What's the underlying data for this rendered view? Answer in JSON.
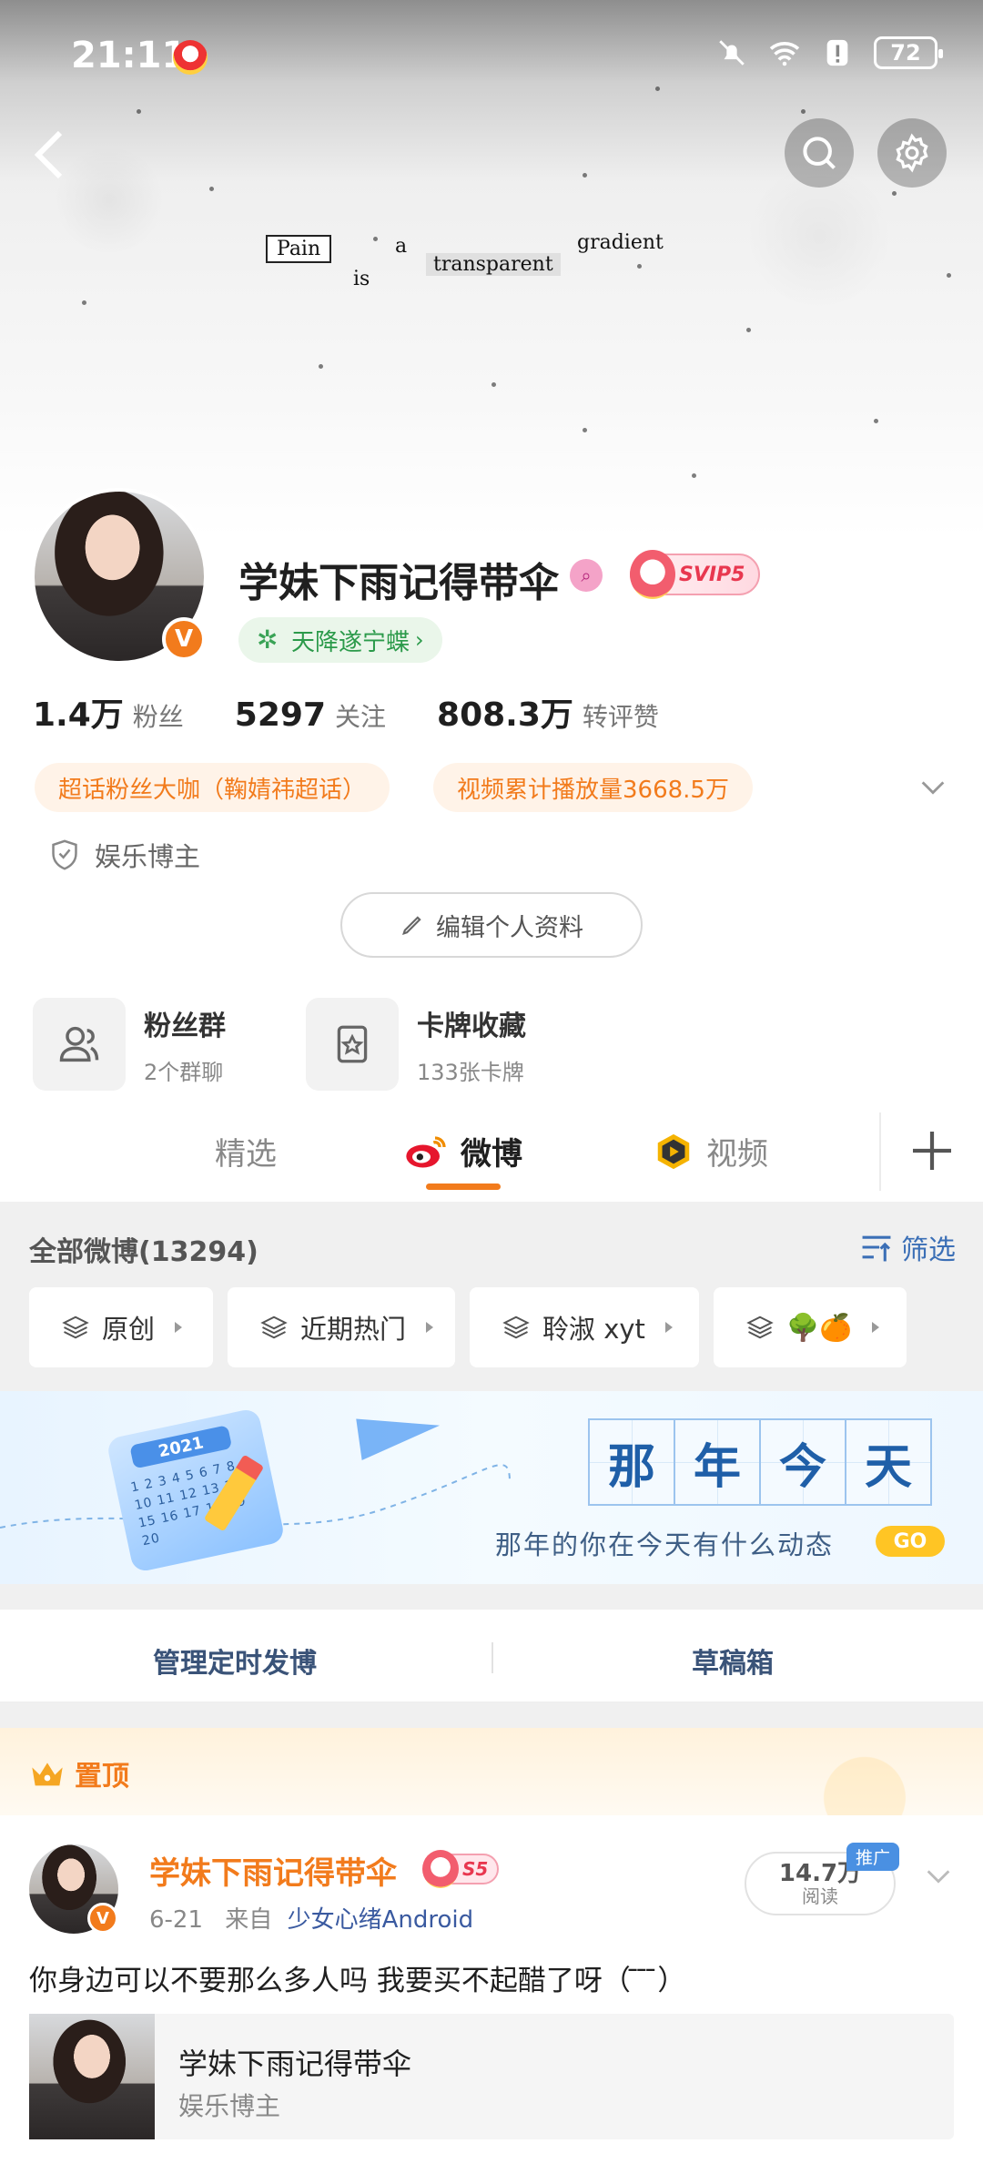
{
  "status": {
    "time": "21:11",
    "battery": "72"
  },
  "cover": {
    "quote_words": [
      "Pain",
      "is",
      "a",
      "transparent",
      "gradient"
    ]
  },
  "profile": {
    "name": "学妹下雨记得带伞",
    "svip_label": "SVIP5",
    "chaohua": "天降遂宁蝶",
    "stats": [
      {
        "num": "1.4万",
        "label": "粉丝"
      },
      {
        "num": "5297",
        "label": "关注"
      },
      {
        "num": "808.3万",
        "label": "转评赞"
      }
    ],
    "tags": [
      "超话粉丝大咖（鞠婧祎超话）",
      "视频累计播放量3668.5万"
    ],
    "verify": "娱乐博主",
    "edit_label": "编辑个人资料"
  },
  "features": [
    {
      "title": "粉丝群",
      "sub": "2个群聊"
    },
    {
      "title": "卡牌收藏",
      "sub": "133张卡牌"
    }
  ],
  "tabs": [
    "精选",
    "微博",
    "视频"
  ],
  "filter": {
    "title": "全部微博(13294)",
    "button": "筛选",
    "chips": [
      "原创",
      "近期热门",
      "聆淑 xyt",
      "🌳🍊"
    ]
  },
  "banner": {
    "cal_year": "2021",
    "cal_days": "1 2 3 4 5 6 7 8 9 10 11 12 13 14 15 16 17 18 19 20",
    "grid": [
      "那",
      "年",
      "今",
      "天"
    ],
    "subtitle": "那年的你在今天有什么动态",
    "go": "GO"
  },
  "manage": [
    "管理定时发博",
    "草稿箱"
  ],
  "pinned": {
    "label": "置顶",
    "author": "学妹下雨记得带伞",
    "level": "S5",
    "date": "6-21",
    "from_prefix": "来自",
    "source": "少女心绪Android",
    "read_count": "14.7万",
    "read_label": "阅读",
    "ad_tag": "推广",
    "text": "你身边可以不要那么多人吗 我要买不起醋了呀（ ̄ ̄ ̄）",
    "card_title": "学妹下雨记得带伞",
    "card_sub": "娱乐博主"
  },
  "colors": {
    "accent": "#f27b1c",
    "link": "#3b6fb6"
  }
}
